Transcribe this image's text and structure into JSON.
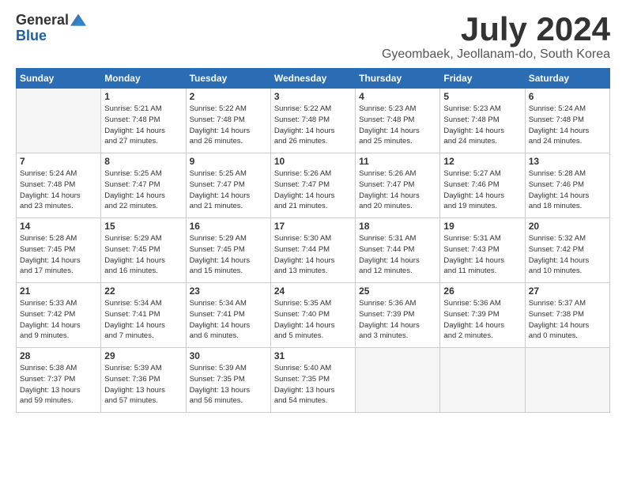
{
  "header": {
    "logo_general": "General",
    "logo_blue": "Blue",
    "month_title": "July 2024",
    "location": "Gyeombaek, Jeollanam-do, South Korea"
  },
  "days_of_week": [
    "Sunday",
    "Monday",
    "Tuesday",
    "Wednesday",
    "Thursday",
    "Friday",
    "Saturday"
  ],
  "weeks": [
    [
      {
        "day": "",
        "info": ""
      },
      {
        "day": "1",
        "info": "Sunrise: 5:21 AM\nSunset: 7:48 PM\nDaylight: 14 hours\nand 27 minutes."
      },
      {
        "day": "2",
        "info": "Sunrise: 5:22 AM\nSunset: 7:48 PM\nDaylight: 14 hours\nand 26 minutes."
      },
      {
        "day": "3",
        "info": "Sunrise: 5:22 AM\nSunset: 7:48 PM\nDaylight: 14 hours\nand 26 minutes."
      },
      {
        "day": "4",
        "info": "Sunrise: 5:23 AM\nSunset: 7:48 PM\nDaylight: 14 hours\nand 25 minutes."
      },
      {
        "day": "5",
        "info": "Sunrise: 5:23 AM\nSunset: 7:48 PM\nDaylight: 14 hours\nand 24 minutes."
      },
      {
        "day": "6",
        "info": "Sunrise: 5:24 AM\nSunset: 7:48 PM\nDaylight: 14 hours\nand 24 minutes."
      }
    ],
    [
      {
        "day": "7",
        "info": "Sunrise: 5:24 AM\nSunset: 7:48 PM\nDaylight: 14 hours\nand 23 minutes."
      },
      {
        "day": "8",
        "info": "Sunrise: 5:25 AM\nSunset: 7:47 PM\nDaylight: 14 hours\nand 22 minutes."
      },
      {
        "day": "9",
        "info": "Sunrise: 5:25 AM\nSunset: 7:47 PM\nDaylight: 14 hours\nand 21 minutes."
      },
      {
        "day": "10",
        "info": "Sunrise: 5:26 AM\nSunset: 7:47 PM\nDaylight: 14 hours\nand 21 minutes."
      },
      {
        "day": "11",
        "info": "Sunrise: 5:26 AM\nSunset: 7:47 PM\nDaylight: 14 hours\nand 20 minutes."
      },
      {
        "day": "12",
        "info": "Sunrise: 5:27 AM\nSunset: 7:46 PM\nDaylight: 14 hours\nand 19 minutes."
      },
      {
        "day": "13",
        "info": "Sunrise: 5:28 AM\nSunset: 7:46 PM\nDaylight: 14 hours\nand 18 minutes."
      }
    ],
    [
      {
        "day": "14",
        "info": "Sunrise: 5:28 AM\nSunset: 7:45 PM\nDaylight: 14 hours\nand 17 minutes."
      },
      {
        "day": "15",
        "info": "Sunrise: 5:29 AM\nSunset: 7:45 PM\nDaylight: 14 hours\nand 16 minutes."
      },
      {
        "day": "16",
        "info": "Sunrise: 5:29 AM\nSunset: 7:45 PM\nDaylight: 14 hours\nand 15 minutes."
      },
      {
        "day": "17",
        "info": "Sunrise: 5:30 AM\nSunset: 7:44 PM\nDaylight: 14 hours\nand 13 minutes."
      },
      {
        "day": "18",
        "info": "Sunrise: 5:31 AM\nSunset: 7:44 PM\nDaylight: 14 hours\nand 12 minutes."
      },
      {
        "day": "19",
        "info": "Sunrise: 5:31 AM\nSunset: 7:43 PM\nDaylight: 14 hours\nand 11 minutes."
      },
      {
        "day": "20",
        "info": "Sunrise: 5:32 AM\nSunset: 7:42 PM\nDaylight: 14 hours\nand 10 minutes."
      }
    ],
    [
      {
        "day": "21",
        "info": "Sunrise: 5:33 AM\nSunset: 7:42 PM\nDaylight: 14 hours\nand 9 minutes."
      },
      {
        "day": "22",
        "info": "Sunrise: 5:34 AM\nSunset: 7:41 PM\nDaylight: 14 hours\nand 7 minutes."
      },
      {
        "day": "23",
        "info": "Sunrise: 5:34 AM\nSunset: 7:41 PM\nDaylight: 14 hours\nand 6 minutes."
      },
      {
        "day": "24",
        "info": "Sunrise: 5:35 AM\nSunset: 7:40 PM\nDaylight: 14 hours\nand 5 minutes."
      },
      {
        "day": "25",
        "info": "Sunrise: 5:36 AM\nSunset: 7:39 PM\nDaylight: 14 hours\nand 3 minutes."
      },
      {
        "day": "26",
        "info": "Sunrise: 5:36 AM\nSunset: 7:39 PM\nDaylight: 14 hours\nand 2 minutes."
      },
      {
        "day": "27",
        "info": "Sunrise: 5:37 AM\nSunset: 7:38 PM\nDaylight: 14 hours\nand 0 minutes."
      }
    ],
    [
      {
        "day": "28",
        "info": "Sunrise: 5:38 AM\nSunset: 7:37 PM\nDaylight: 13 hours\nand 59 minutes."
      },
      {
        "day": "29",
        "info": "Sunrise: 5:39 AM\nSunset: 7:36 PM\nDaylight: 13 hours\nand 57 minutes."
      },
      {
        "day": "30",
        "info": "Sunrise: 5:39 AM\nSunset: 7:35 PM\nDaylight: 13 hours\nand 56 minutes."
      },
      {
        "day": "31",
        "info": "Sunrise: 5:40 AM\nSunset: 7:35 PM\nDaylight: 13 hours\nand 54 minutes."
      },
      {
        "day": "",
        "info": ""
      },
      {
        "day": "",
        "info": ""
      },
      {
        "day": "",
        "info": ""
      }
    ]
  ]
}
